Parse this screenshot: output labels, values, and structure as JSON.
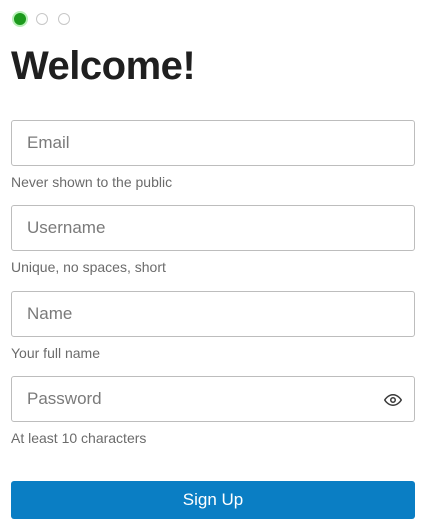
{
  "progress": {
    "current_step": 1,
    "total_steps": 3,
    "active_color": "#1c9a1c"
  },
  "title": "Welcome!",
  "fields": [
    {
      "placeholder": "Email",
      "value": "",
      "help": "Never shown to the public"
    },
    {
      "placeholder": "Username",
      "value": "",
      "help": "Unique, no spaces, short"
    },
    {
      "placeholder": "Name",
      "value": "",
      "help": "Your full name"
    },
    {
      "placeholder": "Password",
      "value": "",
      "help": "At least 10 characters",
      "icon": "eye-icon"
    }
  ],
  "submit": {
    "label": "Sign Up",
    "color": "#0a7ec4"
  }
}
